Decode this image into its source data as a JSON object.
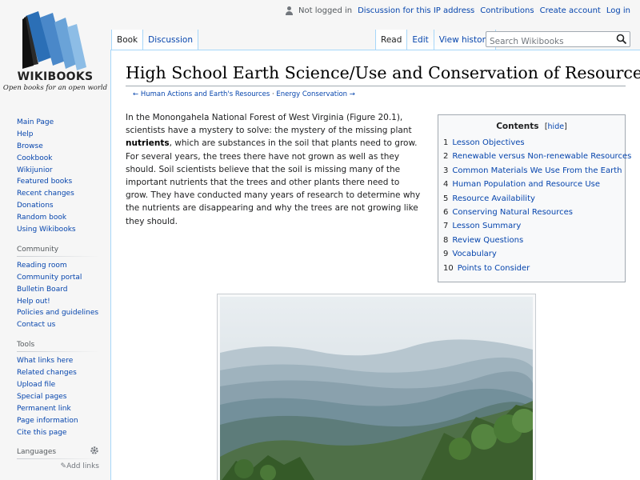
{
  "logo": {
    "wordmark": "WIKIBOOKS",
    "tagline": "Open books for an open world"
  },
  "personal": {
    "not_logged_in": "Not logged in",
    "links": [
      "Discussion for this IP address",
      "Contributions",
      "Create account",
      "Log in"
    ]
  },
  "tabs": {
    "left": [
      "Book",
      "Discussion"
    ],
    "right": [
      "Read",
      "Edit",
      "View history"
    ]
  },
  "search": {
    "placeholder": "Search Wikibooks"
  },
  "page": {
    "title": "High School Earth Science/Use and Conservation of Resources",
    "nav_prev": "← Human Actions and Earth's Resources",
    "nav_sep": " · ",
    "nav_next": "Energy Conservation →",
    "intro_1": "In the Monongahela National Forest of West Virginia (Figure 20.1), scientists have a mystery to solve: the mystery of the missing plant ",
    "intro_bold": "nutrients",
    "intro_2": ", which are substances in the soil that plants need to grow. For several years, the trees there have not grown as well as they should. Soil scientists believe that the soil is missing many of the important nutrients that the trees and other plants there need to grow. They have conducted many years of research to determine why the nutrients are disappearing and why the trees are not growing like they should."
  },
  "toc": {
    "title": "Contents",
    "toggle_open": "[",
    "toggle": "hide",
    "toggle_close": "]",
    "items": [
      {
        "num": "1",
        "label": "Lesson Objectives"
      },
      {
        "num": "2",
        "label": "Renewable versus Non-renewable Resources"
      },
      {
        "num": "3",
        "label": "Common Materials We Use From the Earth"
      },
      {
        "num": "4",
        "label": "Human Population and Resource Use"
      },
      {
        "num": "5",
        "label": "Resource Availability"
      },
      {
        "num": "6",
        "label": "Conserving Natural Resources"
      },
      {
        "num": "7",
        "label": "Lesson Summary"
      },
      {
        "num": "8",
        "label": "Review Questions"
      },
      {
        "num": "9",
        "label": "Vocabulary"
      },
      {
        "num": "10",
        "label": "Points to Consider"
      }
    ]
  },
  "sidebar": {
    "navigation": [
      "Main Page",
      "Help",
      "Browse",
      "Cookbook",
      "Wikijunior",
      "Featured books",
      "Recent changes",
      "Donations",
      "Random book",
      "Using Wikibooks"
    ],
    "community": {
      "heading": "Community",
      "items": [
        "Reading room",
        "Community portal",
        "Bulletin Board",
        "Help out!",
        "Policies and guidelines",
        "Contact us"
      ]
    },
    "tools": {
      "heading": "Tools",
      "items": [
        "What links here",
        "Related changes",
        "Upload file",
        "Special pages",
        "Permanent link",
        "Page information",
        "Cite this page"
      ]
    },
    "languages": {
      "heading": "Languages",
      "add_links": "Add links"
    }
  },
  "colors": {
    "link": "#0645ad",
    "border": "#a7d7f9"
  }
}
